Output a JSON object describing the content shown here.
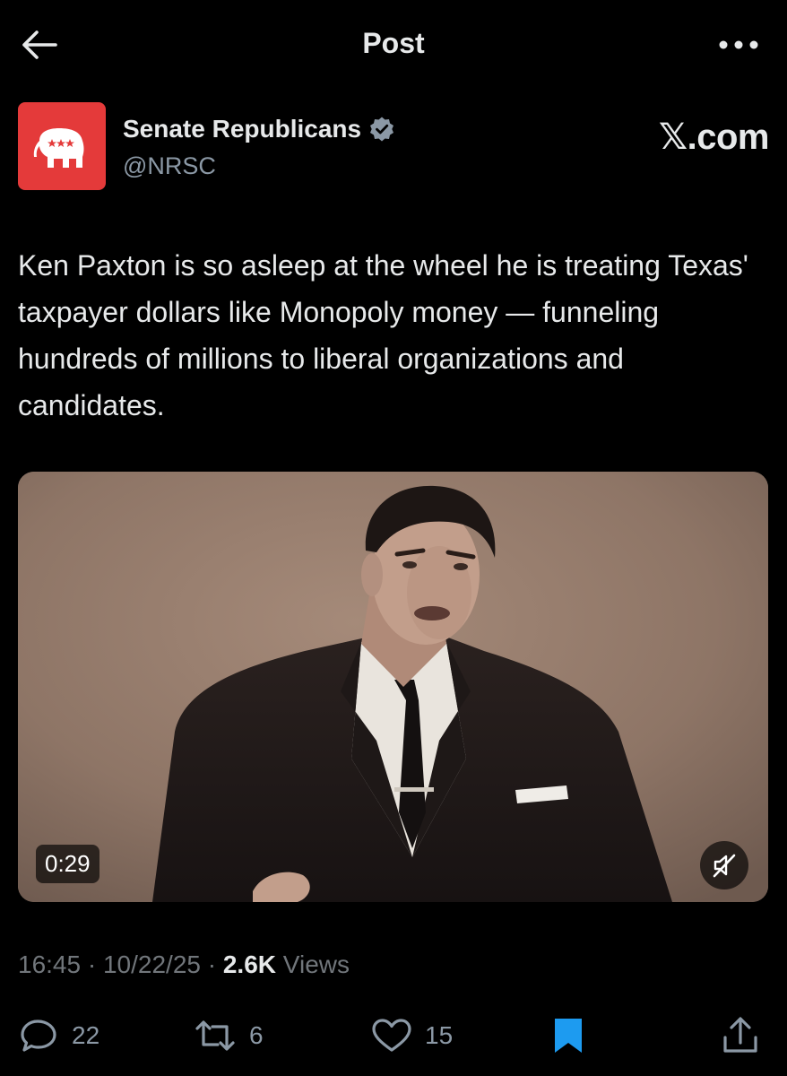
{
  "header": {
    "title": "Post",
    "back_icon": "arrow-left-icon",
    "more_icon": "more-horizontal-icon"
  },
  "author": {
    "name": "Senate Republicans",
    "handle": "@NRSC",
    "verified": true,
    "avatar_bg": "#e43a3a",
    "avatar_icon": "elephant-logo-icon"
  },
  "watermark": "𝕏.com",
  "post": {
    "text": "Ken Paxton is so asleep at the wheel he is treating Texas' taxpayer dollars like Monopoly money — funneling hundreds of millions to liberal organizations and candidates."
  },
  "media": {
    "duration": "0:29",
    "muted": true
  },
  "meta": {
    "time": "16:45",
    "separator": "·",
    "date": "10/22/25",
    "views_count": "2.6K",
    "views_label": "Views"
  },
  "actions": {
    "replies": "22",
    "reposts": "6",
    "likes": "15",
    "bookmarked": true,
    "accent": "#1d9bf0"
  }
}
